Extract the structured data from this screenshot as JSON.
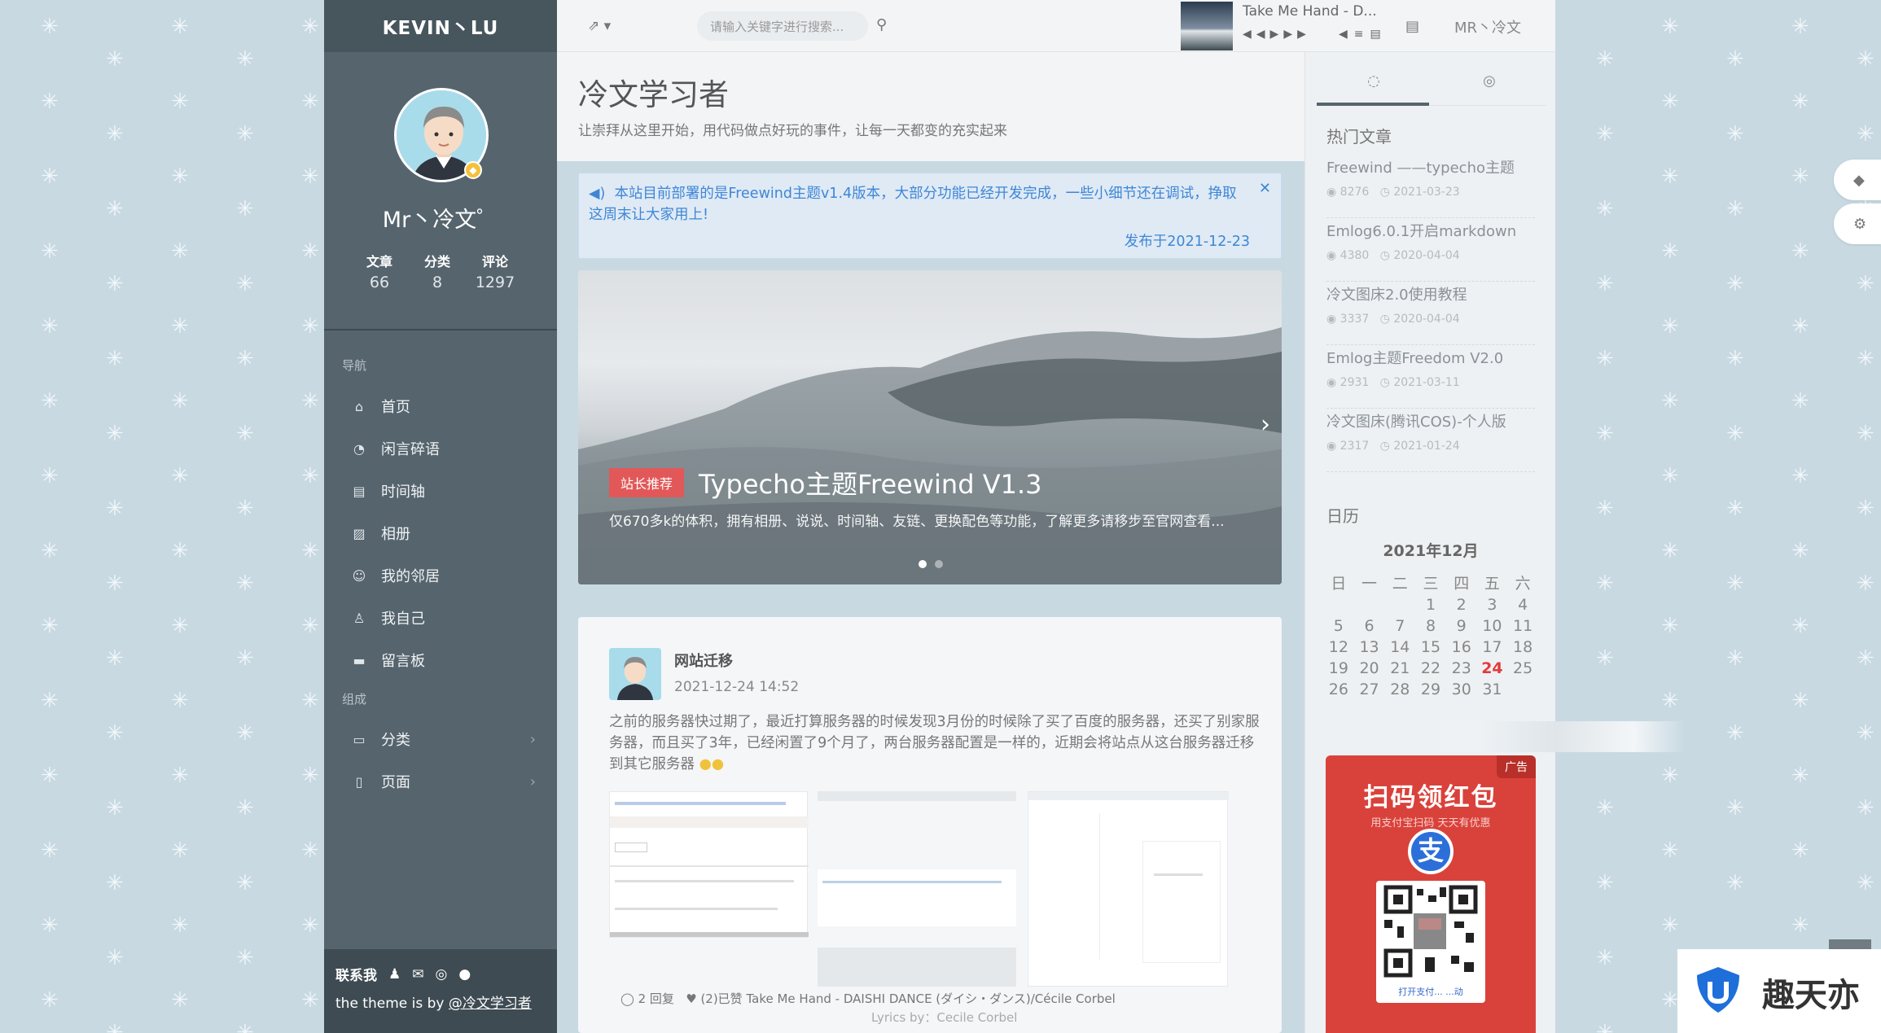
{
  "sidebar": {
    "logo_text": "KEVIN丶LU",
    "profile_name": "Mr丶冷文゜",
    "stats": [
      {
        "label": "文章",
        "value": "66"
      },
      {
        "label": "分类",
        "value": "8"
      },
      {
        "label": "评论",
        "value": "1297"
      }
    ],
    "nav_section_label": "导航",
    "nav_items": [
      {
        "label": "首页",
        "icon": "home-icon"
      },
      {
        "label": "闲言碎语",
        "icon": "clock-icon"
      },
      {
        "label": "时间轴",
        "icon": "timeline-icon"
      },
      {
        "label": "相册",
        "icon": "image-icon"
      },
      {
        "label": "我的邻居",
        "icon": "users-icon"
      },
      {
        "label": "我自己",
        "icon": "user-icon"
      },
      {
        "label": "留言板",
        "icon": "message-icon"
      }
    ],
    "compose_section_label": "组成",
    "compose_items": [
      {
        "label": "分类",
        "icon": "folder-icon"
      },
      {
        "label": "页面",
        "icon": "file-icon"
      }
    ],
    "contact_label": "联系我",
    "theme_prefix": "the theme is by ",
    "theme_link": "@冷文学习者"
  },
  "topbar": {
    "search_placeholder": "请输入关键字进行搜索...",
    "song_title": "Take Me Hand - D...",
    "user_name": "MR丶冷文"
  },
  "header": {
    "title": "冷文学习者",
    "subtitle": "让崇拜从这里开始，用代码做点好玩的事件，让每一天都变的充实起来"
  },
  "notice": {
    "text": "本站目前部署的是Freewind主题v1.4版本，大部分功能已经开发完成，一些小细节还在调试，挣取这周末让大家用上!",
    "date": "发布于2021-12-23"
  },
  "slider": {
    "tag": "站长推荐",
    "title": "Typecho主题Freewind V1.3",
    "description": "仅670多k的体积，拥有相册、说说、时间轴、友链、更换配色等功能，了解更多请移步至官网查看..."
  },
  "post": {
    "title": "网站迁移",
    "date": "2021-12-24 14:52",
    "body": "之前的服务器快过期了，最近打算服务器的时候发现3月份的时候除了买了百度的服务器，还买了别家服务器，而且买了3年，已经闲置了9个月了，两台服务器配置是一样的，近期会将站点从这台服务器迁移到其它服务器",
    "replies": "2 回复",
    "liked": "(2)已赞 Take Me Hand - DAISHI DANCE (ダイシ・ダンス)/Cécile Corbel",
    "lyrics": "Lyrics by：Cecile Corbel"
  },
  "right_sidebar": {
    "hot_heading": "热门文章",
    "hot_posts": [
      {
        "title": "Freewind ——typecho主题",
        "views": "8276",
        "date": "2021-03-23"
      },
      {
        "title": "Emlog6.0.1开启markdown",
        "views": "4380",
        "date": "2020-04-04"
      },
      {
        "title": "冷文图床2.0使用教程",
        "views": "3337",
        "date": "2020-04-04"
      },
      {
        "title": "Emlog主题Freedom V2.0",
        "views": "2931",
        "date": "2021-03-11"
      },
      {
        "title": "冷文图床(腾讯COS)-个人版",
        "views": "2317",
        "date": "2021-01-24"
      }
    ],
    "calendar_heading": "日历",
    "calendar_month": "2021年12月",
    "weekdays": [
      "日",
      "一",
      "二",
      "三",
      "四",
      "五",
      "六"
    ],
    "today": "24"
  },
  "ad": {
    "tag": "广告",
    "title": "扫码领红包",
    "subtitle": "用支付宝扫码 天天有优惠",
    "logo_char": "支",
    "qr_caption": "打开支付...   ...动"
  },
  "watermark": {
    "text": "趣天亦"
  },
  "colors": {
    "sidebar": "#56646d",
    "accent_red": "#e25858",
    "link_blue": "#3f86d6",
    "today": "#e33b3b"
  }
}
